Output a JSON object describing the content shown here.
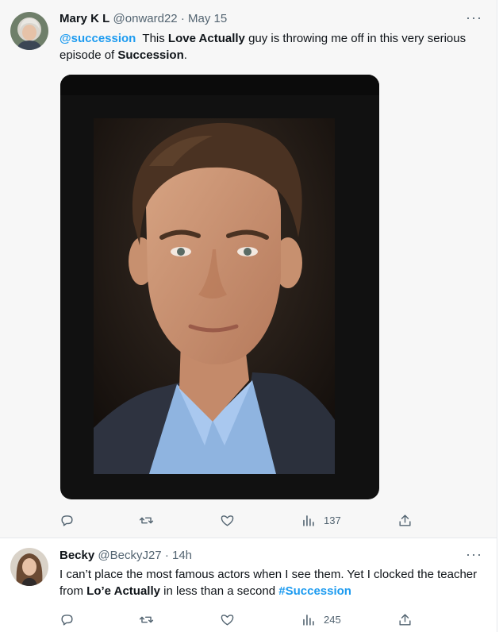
{
  "tweets": [
    {
      "name": "Mary K L",
      "handle": "@onward22",
      "separator": "·",
      "date": "May 15",
      "more": "···",
      "text": {
        "mention": "@succession",
        "t1": "  This ",
        "b1": "Love Actually",
        "t2": " guy is throwing me off in this very serious episode of ",
        "b2": "Succession",
        "t3": "."
      },
      "views": "137",
      "media_icon": "photo-man-portrait"
    },
    {
      "name": "Becky",
      "handle": "@BeckyJ27",
      "separator": "·",
      "date": "14h",
      "more": "···",
      "text": {
        "t1": "I can’t place the most famous actors when I see them. Yet I clocked the teacher from ",
        "b1": "Lo’e Actually",
        "t2": " in less than a second ",
        "hashtag": "#Succession"
      },
      "views": "245"
    }
  ],
  "icons": [
    "reply-icon",
    "retweet-icon",
    "like-icon",
    "views-icon",
    "share-icon"
  ],
  "colors": {
    "link": "#1d9bf0",
    "meta": "#536471",
    "text": "#0f1419"
  }
}
